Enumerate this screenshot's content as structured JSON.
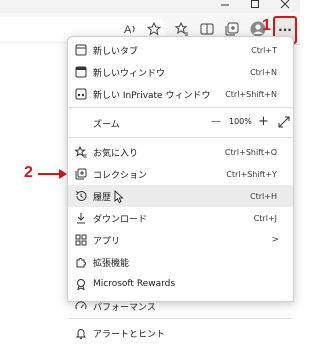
{
  "colors": {
    "annotation": "#d6141a",
    "menu_bg": "#ffffff",
    "hover_bg": "#ececec"
  },
  "toolbar": {
    "icons": [
      "read-aloud-icon",
      "add-favorite-icon",
      "favorites-icon",
      "split-screen-icon",
      "collections-icon",
      "profile-avatar-icon",
      "more-menu-icon"
    ],
    "more_label": "···"
  },
  "annotations": {
    "marker_1": "1",
    "marker_2": "2"
  },
  "menu": {
    "new_tab": {
      "label": "新しいタブ",
      "shortcut": "Ctrl+T"
    },
    "new_window": {
      "label": "新しいウィンドウ",
      "shortcut": "Ctrl+N"
    },
    "new_inprivate": {
      "label": "新しい InPrivate ウィンドウ",
      "shortcut": "Ctrl+Shift+N"
    },
    "zoom": {
      "label": "ズーム",
      "minus": "—",
      "value": "100%",
      "plus": "+"
    },
    "favorites": {
      "label": "お気に入り",
      "shortcut": "Ctrl+Shift+O"
    },
    "collections": {
      "label": "コレクション",
      "shortcut": "Ctrl+Shift+Y"
    },
    "history": {
      "label": "履歴",
      "shortcut": "Ctrl+H"
    },
    "downloads": {
      "label": "ダウンロード",
      "shortcut": "Ctrl+J"
    },
    "apps": {
      "label": "アプリ",
      "arrow": ">"
    },
    "extensions": {
      "label": "拡張機能"
    },
    "rewards": {
      "label": "Microsoft Rewards"
    },
    "performance": {
      "label": "パフォーマンス"
    },
    "alerts": {
      "label": "アラートとヒント"
    }
  }
}
